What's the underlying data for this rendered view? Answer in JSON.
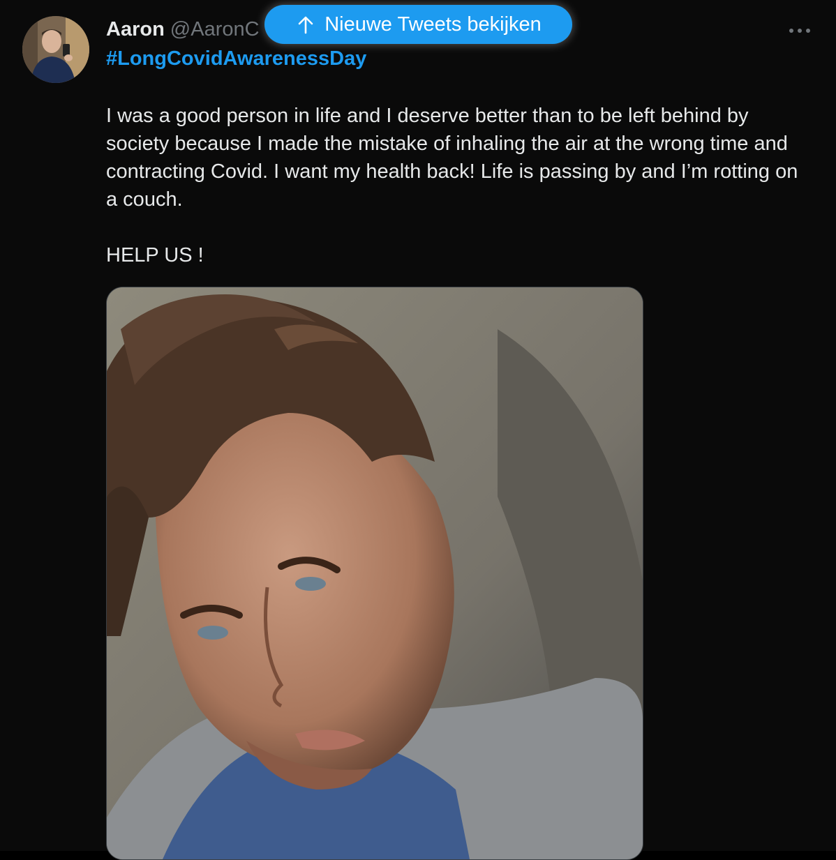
{
  "tweet": {
    "display_name": "Aaron",
    "handle": "@AaronC",
    "hashtag": "#LongCovidAwarenessDay",
    "body": "I was a good person in life and I deserve better than to be left behind by society because I made the mistake of inhaling the air at the wrong time and contracting Covid. I want my health back! Life is passing by and I’m rotting on a couch.",
    "closing": "HELP US !"
  },
  "banner": {
    "label": "Nieuwe Tweets bekijken",
    "icon": "arrow-up-icon"
  },
  "menu": {
    "icon": "more-dots-icon"
  },
  "colors": {
    "accent": "#1d9bf0",
    "background": "#0a0a0a",
    "text": "#e7e9ea",
    "muted": "#71767b"
  }
}
